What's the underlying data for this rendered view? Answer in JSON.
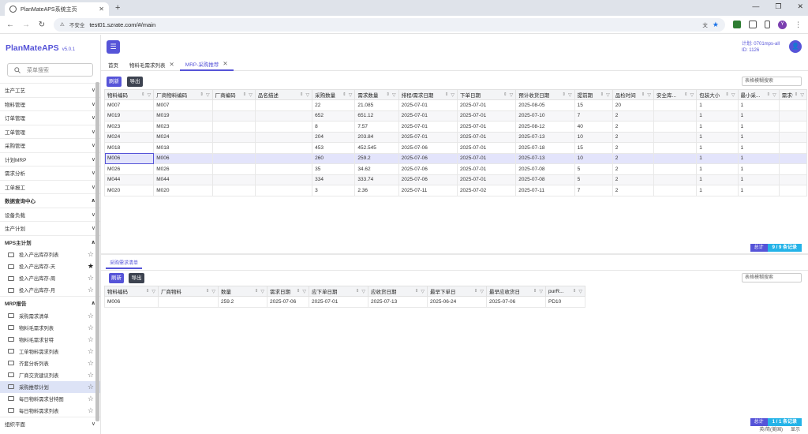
{
  "browser": {
    "tab_title": "PlanMateAPS系统主页",
    "security_label": "不安全",
    "url": "test01.szrate.com/#/main"
  },
  "sidebar": {
    "brand": "PlanMateAPS",
    "version": "v5.0.1",
    "search_placeholder": "菜单搜索",
    "menus": [
      {
        "label": "生产工艺",
        "chev": "∨"
      },
      {
        "label": "物料管理",
        "chev": "∨"
      },
      {
        "label": "订单管理",
        "chev": "∨"
      },
      {
        "label": "工单管理",
        "chev": "∨"
      },
      {
        "label": "采购管理",
        "chev": "∨"
      },
      {
        "label": "计划MRP",
        "chev": "∨"
      },
      {
        "label": "需求分析",
        "chev": "∨"
      },
      {
        "label": "工单报工",
        "chev": "∨"
      },
      {
        "label": "数据查询中心",
        "chev": "∧"
      },
      {
        "label": "设备负载",
        "chev": "∨"
      },
      {
        "label": "生产计划",
        "chev": "∨"
      },
      {
        "label": "MPS主计划",
        "chev": "∧"
      }
    ],
    "mps_items": [
      {
        "label": "投入产出库存列表",
        "star": "☆"
      },
      {
        "label": "投入产出库存-天",
        "star": "★"
      },
      {
        "label": "投入产出库存-周",
        "star": "☆"
      },
      {
        "label": "投入产出库存-月",
        "star": "☆"
      }
    ],
    "mrp_header": {
      "label": "MRP报告",
      "chev": "∧"
    },
    "mrp_items": [
      {
        "label": "采购需求清单",
        "star": "☆"
      },
      {
        "label": "物料毛需求列表",
        "star": "☆"
      },
      {
        "label": "物料毛需求甘特",
        "star": "☆"
      },
      {
        "label": "工单物料需求列表",
        "star": "☆"
      },
      {
        "label": "齐套分析列表",
        "star": "☆"
      },
      {
        "label": "厂商交货建议列表",
        "star": "☆"
      },
      {
        "label": "采购推荐计划",
        "star": "☆"
      },
      {
        "label": "每日物料需求甘特图",
        "star": "☆"
      },
      {
        "label": "每日物料需求列表",
        "star": "☆"
      }
    ],
    "bottom_menu": {
      "label": "组织平面",
      "chev": "∨"
    }
  },
  "header": {
    "user_line1": "计划: 0701mps-all",
    "user_line2": "ID: 1126"
  },
  "page_tabs": [
    {
      "label": "首页",
      "closable": false
    },
    {
      "label": "物料毛需求列表",
      "closable": true
    },
    {
      "label": "MRP-采购推荐",
      "closable": true
    }
  ],
  "top_table": {
    "refresh_label": "刷新",
    "export_label": "导出",
    "search_placeholder": "表格模糊搜索",
    "columns": [
      "物料编码",
      "厂商物料编码",
      "厂商编码",
      "品名描述",
      "采购数量",
      "需求数量",
      "排程/需求日期",
      "下单日期",
      "预计收货日期",
      "提前期",
      "品检时间",
      "安全库...",
      "包装大小",
      "最小采...",
      "需求合..."
    ],
    "rows": [
      [
        "M007",
        "M007",
        "",
        "",
        "22",
        "21.085",
        "2025-07-01",
        "2025-07-01",
        "2025-08-05",
        "15",
        "20",
        "",
        "1",
        "1",
        ""
      ],
      [
        "M019",
        "M019",
        "",
        "",
        "652",
        "651.12",
        "2025-07-01",
        "2025-07-01",
        "2025-07-10",
        "7",
        "2",
        "",
        "1",
        "1",
        ""
      ],
      [
        "M023",
        "M023",
        "",
        "",
        "8",
        "7.57",
        "2025-07-01",
        "2025-07-01",
        "2025-08-12",
        "40",
        "2",
        "",
        "1",
        "1",
        ""
      ],
      [
        "M024",
        "M024",
        "",
        "",
        "204",
        "203.84",
        "2025-07-01",
        "2025-07-01",
        "2025-07-13",
        "10",
        "2",
        "",
        "1",
        "1",
        ""
      ],
      [
        "M018",
        "M018",
        "",
        "",
        "453",
        "452.545",
        "2025-07-06",
        "2025-07-01",
        "2025-07-18",
        "15",
        "2",
        "",
        "1",
        "1",
        ""
      ],
      [
        "M006",
        "M006",
        "",
        "",
        "260",
        "259.2",
        "2025-07-06",
        "2025-07-01",
        "2025-07-13",
        "10",
        "2",
        "",
        "1",
        "1",
        ""
      ],
      [
        "M026",
        "M026",
        "",
        "",
        "35",
        "34.62",
        "2025-07-06",
        "2025-07-01",
        "2025-07-08",
        "5",
        "2",
        "",
        "1",
        "1",
        ""
      ],
      [
        "M044",
        "M044",
        "",
        "",
        "334",
        "333.74",
        "2025-07-06",
        "2025-07-01",
        "2025-07-08",
        "5",
        "2",
        "",
        "1",
        "1",
        ""
      ],
      [
        "M020",
        "M020",
        "",
        "",
        "3",
        "2.36",
        "2025-07-11",
        "2025-07-02",
        "2025-07-11",
        "7",
        "2",
        "",
        "1",
        "1",
        ""
      ]
    ],
    "selected_row": 5,
    "pager_total_label": "总计",
    "pager_count": "9 / 9 条记录"
  },
  "bottom_section": {
    "tab_label": "采购需求清单",
    "refresh_label": "刷新",
    "export_label": "导出",
    "search_placeholder": "表格模糊搜索",
    "columns": [
      "物料编码",
      "厂商物料",
      "数量",
      "需求日期",
      "应下单日期",
      "应收货日期",
      "最早下单日",
      "最早应收货日",
      "purR..."
    ],
    "rows": [
      [
        "M006",
        "",
        "259.2",
        "2025-07-06",
        "2025-07-01",
        "2025-07-13",
        "2025-06-24",
        "2025-07-06",
        "PD10"
      ]
    ],
    "pager_total_label": "总计",
    "pager_count": "1 / 1 条记录"
  },
  "status": {
    "ime1": "英/简(美国)",
    "ime2": "显示"
  }
}
